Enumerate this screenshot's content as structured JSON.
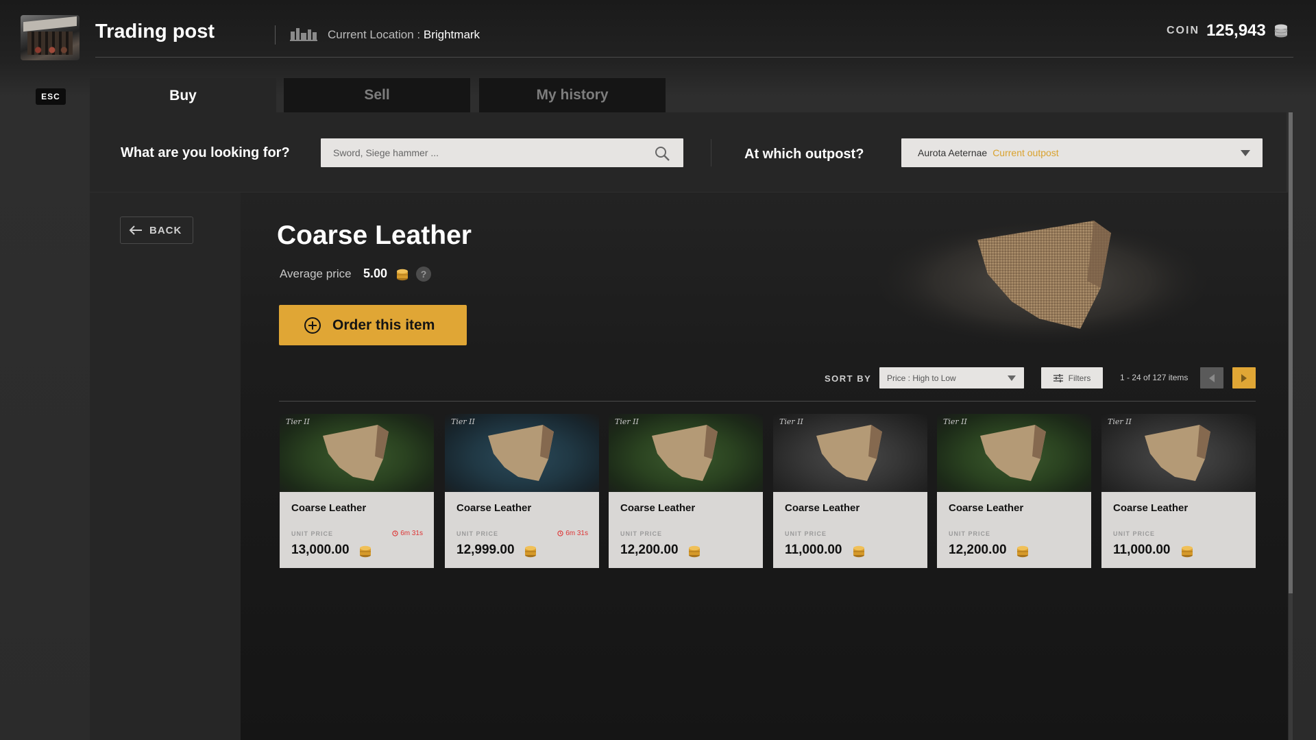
{
  "header": {
    "title": "Trading post",
    "location_label": "Current Location :",
    "location_value": "Brightmark",
    "coin_label": "COIN",
    "coin_value": "125,943"
  },
  "esc_label": "ESC",
  "tabs": [
    {
      "label": "Buy",
      "active": true
    },
    {
      "label": "Sell",
      "active": false
    },
    {
      "label": "My history",
      "active": false
    }
  ],
  "search": {
    "question": "What are you looking for?",
    "placeholder": "Sword, Siege hammer ..."
  },
  "outpost": {
    "question": "At which outpost?",
    "selected": "Aurota Aeternae",
    "tag": "Current outpost"
  },
  "back_label": "BACK",
  "item": {
    "name": "Coarse Leather",
    "avg_label": "Average price",
    "avg_value": "5.00",
    "help": "?",
    "order_label": "Order this item"
  },
  "listing": {
    "sort_label": "SORT BY",
    "sort_value": "Price : High to Low",
    "filters_label": "Filters",
    "pager_text": "1 - 24 of 127 items"
  },
  "cards": [
    {
      "tier": "Tier II",
      "name": "Coarse Leather",
      "unit_label": "UNIT PRICE",
      "timer": "6m 31s",
      "price": "13,000.00",
      "bg": "green"
    },
    {
      "tier": "Tier II",
      "name": "Coarse Leather",
      "unit_label": "UNIT PRICE",
      "timer": "6m 31s",
      "price": "12,999.00",
      "bg": "blue"
    },
    {
      "tier": "Tier II",
      "name": "Coarse Leather",
      "unit_label": "UNIT PRICE",
      "timer": "",
      "price": "12,200.00",
      "bg": "green"
    },
    {
      "tier": "Tier II",
      "name": "Coarse Leather",
      "unit_label": "UNIT PRICE",
      "timer": "",
      "price": "11,000.00",
      "bg": "gray"
    },
    {
      "tier": "Tier II",
      "name": "Coarse Leather",
      "unit_label": "UNIT PRICE",
      "timer": "",
      "price": "12,200.00",
      "bg": "green"
    },
    {
      "tier": "Tier II",
      "name": "Coarse Leather",
      "unit_label": "UNIT PRICE",
      "timer": "",
      "price": "11,000.00",
      "bg": "gray"
    }
  ],
  "colors": {
    "accent": "#e0a635",
    "timer": "#dd3333",
    "card_body": "#d9d7d5",
    "panel": "#262626"
  }
}
